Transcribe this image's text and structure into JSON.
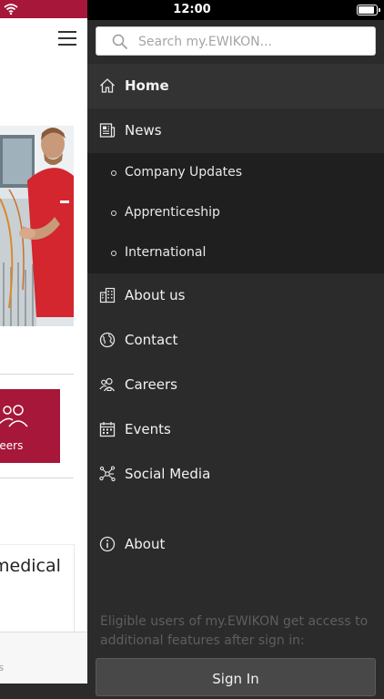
{
  "status_bar": {
    "time": "12:00"
  },
  "background_page": {
    "careers_tile_label": "rreers",
    "card_title": "medical",
    "bottom_tab_label": "ts"
  },
  "search": {
    "placeholder": "Search my.EWIKON..."
  },
  "menu": {
    "items": [
      {
        "label": "Home",
        "icon": "home-icon",
        "active": true
      },
      {
        "label": "News",
        "icon": "newspaper-icon"
      },
      {
        "label": "About us",
        "icon": "buildings-icon"
      },
      {
        "label": "Contact",
        "icon": "globe-icon"
      },
      {
        "label": "Careers",
        "icon": "people-icon"
      },
      {
        "label": "Events",
        "icon": "calendar-icon"
      },
      {
        "label": "Social Media",
        "icon": "network-icon"
      }
    ],
    "news_subitems": [
      {
        "label": "Company Updates"
      },
      {
        "label": "Apprenticeship"
      },
      {
        "label": "International"
      }
    ],
    "about": {
      "label": "About",
      "icon": "info-icon"
    }
  },
  "sign_in": {
    "note": "Eligible users of my.EWIKON get access to additional features after sign in:",
    "button_label": "Sign In"
  },
  "colors": {
    "brand_red": "#a6173a",
    "drawer_bg": "#2b2b2b",
    "submenu_bg": "#1f1f1f",
    "active_bg": "#333333"
  }
}
